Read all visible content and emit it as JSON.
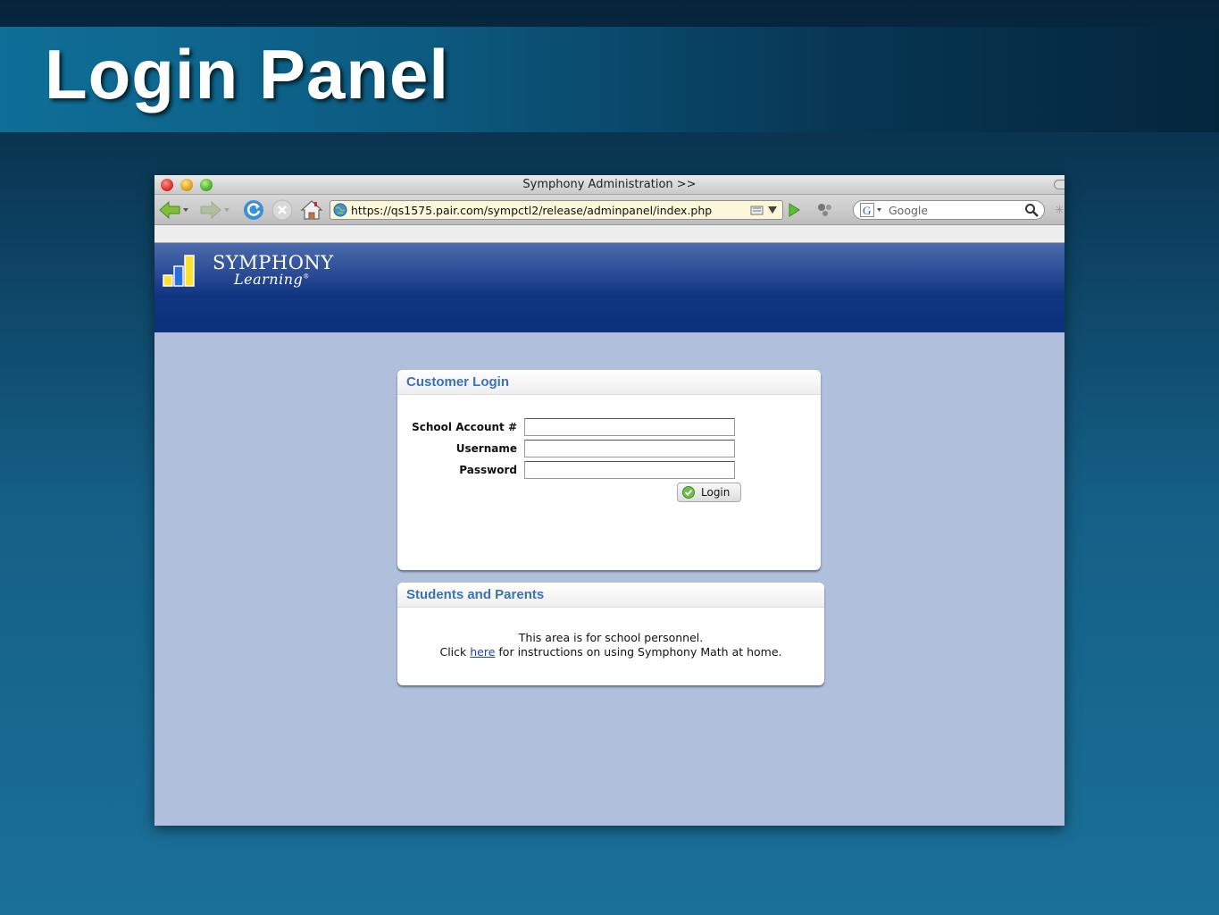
{
  "slide": {
    "title": "Login Panel"
  },
  "window": {
    "title": "Symphony Administration >>"
  },
  "navbar": {
    "url": "https://qs1575.pair.com/sympctl2/release/adminpanel/index.php",
    "search_placeholder": "Google"
  },
  "header": {
    "logo_line1": "SYMPHONY",
    "logo_line2": "Learning",
    "logo_mark": "®"
  },
  "login_panel": {
    "title": "Customer Login",
    "fields": [
      {
        "label": "School Account #",
        "value": ""
      },
      {
        "label": "Username",
        "value": ""
      },
      {
        "label": "Password",
        "value": ""
      }
    ],
    "login_label": "Login"
  },
  "info_panel": {
    "title": "Students and Parents",
    "line1": "This area is for school personnel.",
    "line2_prefix": "Click",
    "link_text": "here",
    "line2_suffix": "for instructions on using Symphony Math at home."
  },
  "colors": {
    "accent": "#3c72b5",
    "header_blue": "#0a3179",
    "page_bg": "#b0c0dc"
  }
}
